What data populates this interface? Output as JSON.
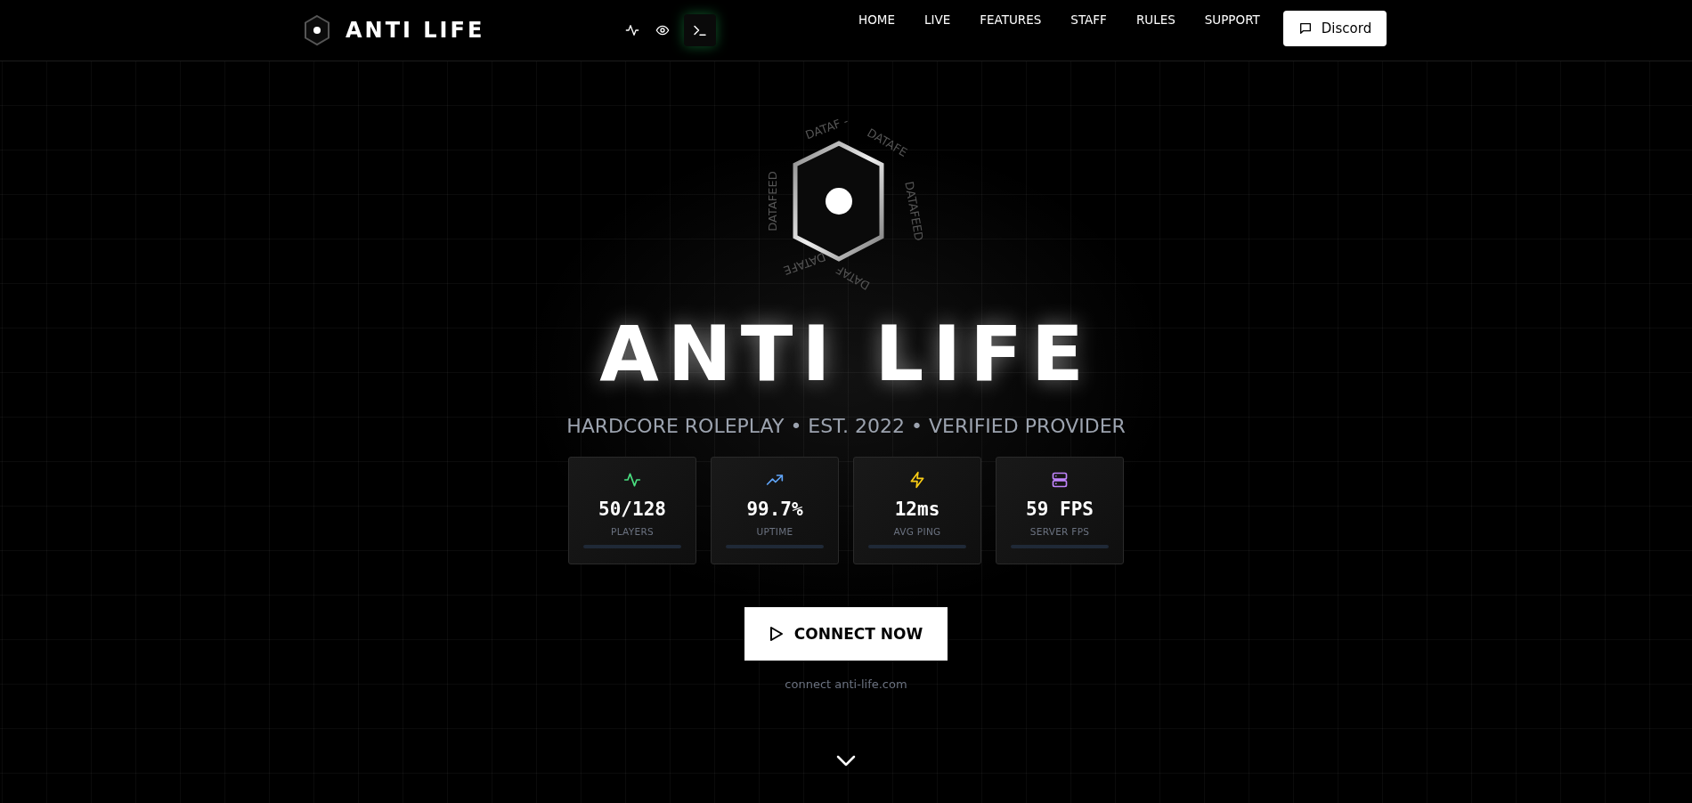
{
  "brand": {
    "name": "ANTI LIFE"
  },
  "header_tools": [
    {
      "kind": "pulse"
    },
    {
      "kind": "eye"
    },
    {
      "kind": "terminal"
    }
  ],
  "nav": [
    {
      "label": "HOME"
    },
    {
      "label": "LIVE"
    },
    {
      "label": "FEATURES"
    },
    {
      "label": "STAFF"
    },
    {
      "label": "RULES"
    },
    {
      "label": "SUPPORT"
    }
  ],
  "discord_button": {
    "label": "Discord"
  },
  "emblem": {
    "orbit_labels": [
      "DATAF -",
      "DATAFE",
      "DATAFEED",
      "DATAF",
      "DATAFE",
      "DATAFEED"
    ]
  },
  "hero": {
    "title": "ANTI LIFE",
    "subtitle": "HARDCORE ROLEPLAY • EST. 2022 • VERIFIED PROVIDER"
  },
  "stats": [
    {
      "kind": "pulse",
      "color": "#4ade80",
      "value": "50/128",
      "label": "PLAYERS"
    },
    {
      "kind": "trend",
      "color": "#60a5fa",
      "value": "99.7%",
      "label": "UPTIME"
    },
    {
      "kind": "bolt",
      "color": "#facc15",
      "value": "12ms",
      "label": "AVG PING"
    },
    {
      "kind": "server",
      "color": "#c084fc",
      "value": "59 FPS",
      "label": "SERVER FPS"
    }
  ],
  "connect_button": {
    "label": "CONNECT NOW"
  },
  "connect_hint": "connect anti-life.com"
}
